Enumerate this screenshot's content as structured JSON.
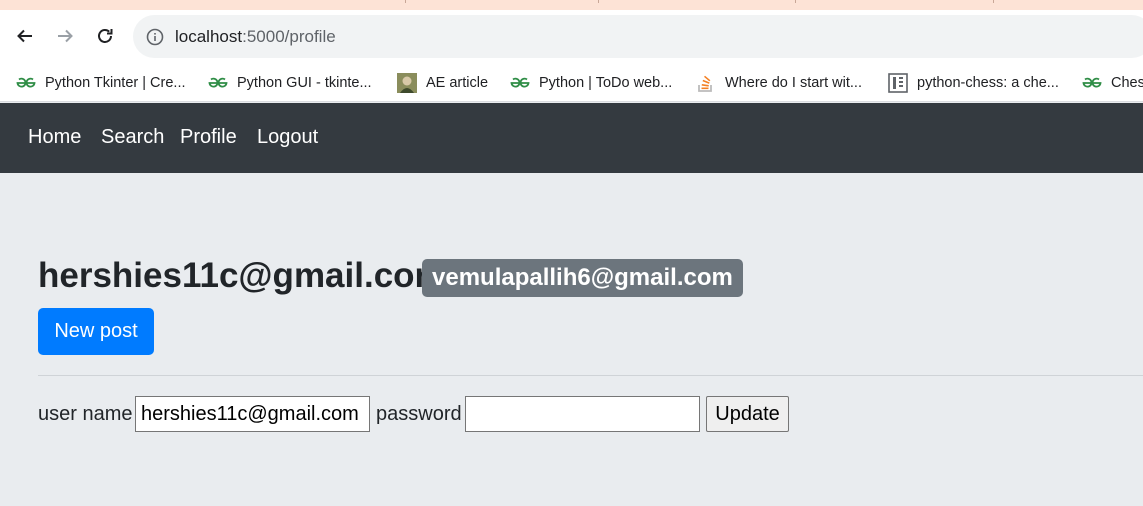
{
  "browser": {
    "url_host": "localhost",
    "url_rest": ":5000/profile",
    "icons": {
      "back": "arrow-left-icon",
      "forward": "arrow-right-icon",
      "reload": "reload-icon",
      "info": "info-icon"
    },
    "bookmarks": [
      {
        "label": "Python Tkinter | Cre...",
        "icon": "geeksforgeeks-icon"
      },
      {
        "label": "Python GUI - tkinte...",
        "icon": "geeksforgeeks-icon"
      },
      {
        "label": "AE article",
        "icon": "portrait-favicon"
      },
      {
        "label": "Python | ToDo web...",
        "icon": "geeksforgeeks-icon"
      },
      {
        "label": "Where do I start wit...",
        "icon": "stackoverflow-icon"
      },
      {
        "label": "python-chess: a che...",
        "icon": "docs-icon"
      },
      {
        "label": "Ches",
        "icon": "geeksforgeeks-icon"
      }
    ]
  },
  "nav": {
    "home": "Home",
    "search": "Search",
    "profile": "Profile",
    "logout": "Logout"
  },
  "profile": {
    "email": "hershies11c@gmail.com",
    "badge": "vemulapallih6@gmail.com",
    "new_post": "New post"
  },
  "form": {
    "username_label": "user name",
    "username_value": "hershies11c@gmail.com",
    "password_label": "password",
    "password_value": "",
    "update_label": "Update"
  },
  "colors": {
    "navbar": "#343a40",
    "primary": "#007bff",
    "badge": "#6c757d",
    "page_bg": "#e9ecef"
  }
}
